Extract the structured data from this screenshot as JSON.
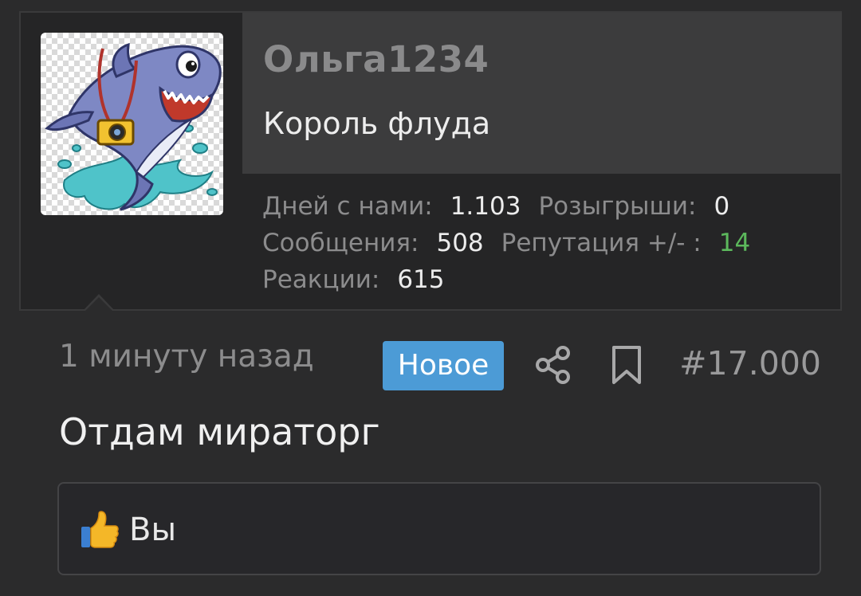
{
  "user": {
    "username": "Ольга1234",
    "title": "Король флуда",
    "avatar_icon": "shark-with-camera-avatar",
    "stats": [
      {
        "label": "Дней с нами:",
        "value": "1.103"
      },
      {
        "label": "Розыгрыши:",
        "value": "0"
      },
      {
        "label": "Сообщения:",
        "value": "508"
      },
      {
        "label": "Репутация +/- :",
        "value": "14",
        "color": "#5cb85c"
      },
      {
        "label": "Реакции:",
        "value": "615"
      }
    ]
  },
  "post": {
    "time": "1 минуту назад",
    "badge": "Новое",
    "badge_color": "#4c9bd6",
    "share_icon": "share-icon",
    "bookmark_icon": "bookmark-icon",
    "number": "#17.000",
    "content": "Отдам мираторг",
    "reaction": {
      "icon": "thumbs-up-icon",
      "text": "Вы"
    }
  }
}
